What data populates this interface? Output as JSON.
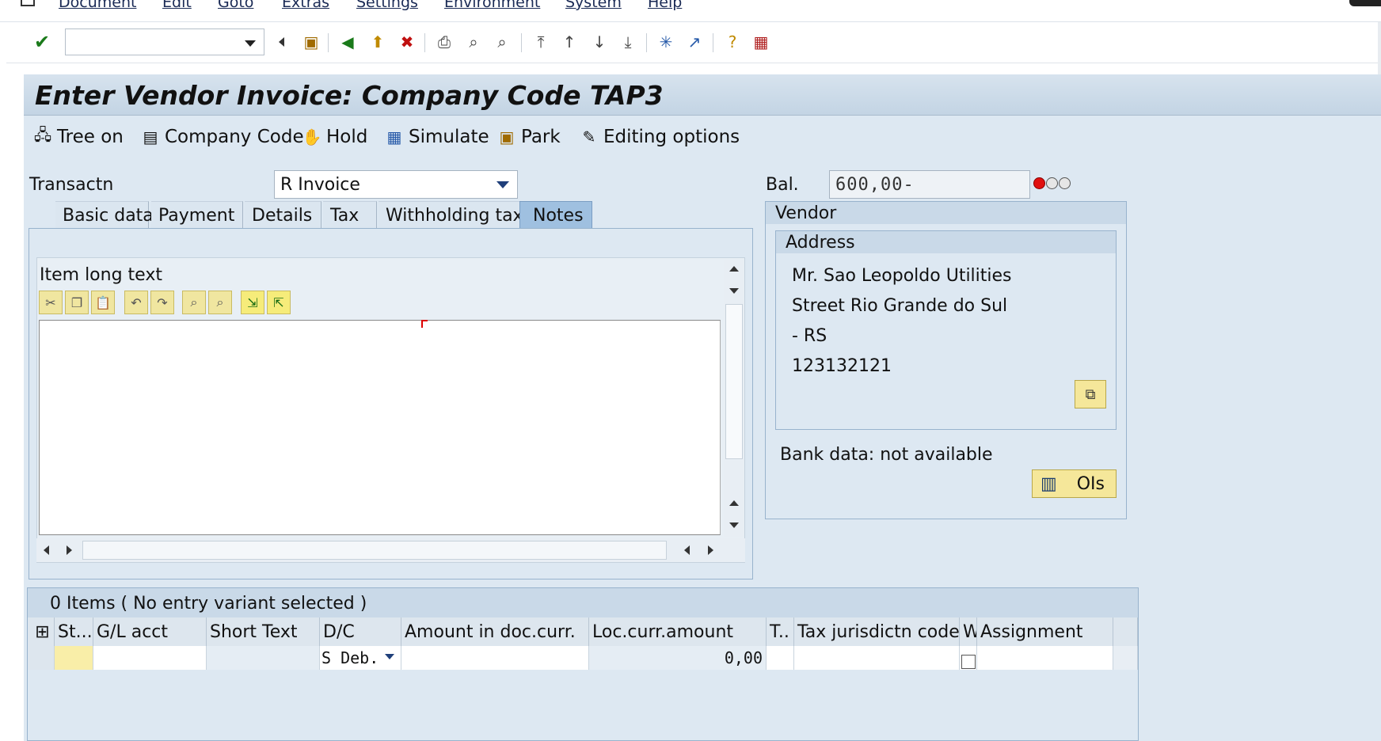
{
  "menu": [
    "Document",
    "Edit",
    "Goto",
    "Extras",
    "Settings",
    "Environment",
    "System",
    "Help"
  ],
  "toolbar": {
    "command_value": "",
    "icons": [
      "enter-icon",
      "back-small-icon",
      "save-icon",
      "back-icon",
      "exit-icon",
      "cancel-icon",
      "print-icon",
      "find-icon",
      "find-next-icon",
      "first-page-icon",
      "prev-page-icon",
      "next-page-icon",
      "last-page-icon",
      "create-session-icon",
      "shortcut-icon",
      "help-icon",
      "layout-icon"
    ]
  },
  "title": "Enter Vendor Invoice: Company Code TAP3",
  "app_toolbar": {
    "tree": "Tree on",
    "company_code": "Company Code",
    "hold": "Hold",
    "simulate": "Simulate",
    "park": "Park",
    "editing_options": "Editing options"
  },
  "transaction": {
    "label": "Transactn",
    "value": "R Invoice"
  },
  "balance": {
    "label": "Bal.",
    "value": "600,00-",
    "status": "red"
  },
  "tabs": [
    "Basic data",
    "Payment",
    "Details",
    "Tax",
    "Withholding tax",
    "Notes"
  ],
  "active_tab": "Notes",
  "notes": {
    "title": "Item long text",
    "text": ""
  },
  "vendor": {
    "title": "Vendor",
    "address_title": "Address",
    "address_lines": [
      "Mr. Sao Leopoldo Utilities",
      "Street Rio Grande do Sul",
      "- RS",
      "123132121"
    ],
    "bank_data": "Bank data: not available",
    "ois_label": "OIs"
  },
  "items": {
    "summary": "0 Items ( No entry variant selected )",
    "columns": [
      "St...",
      "G/L acct",
      "Short Text",
      "D/C",
      "Amount in doc.curr.",
      "Loc.curr.amount",
      "T..",
      "Tax jurisdictn code",
      "W",
      "Assignment"
    ],
    "rows": [
      {
        "dc": "S Deb.",
        "loc_amount": "0,00"
      }
    ]
  },
  "colors": {
    "header_bg": "#c9d9e8",
    "panel_bg": "#dde8f2",
    "accent": "#9fc0e0",
    "button_yellow": "#f5e79a"
  }
}
